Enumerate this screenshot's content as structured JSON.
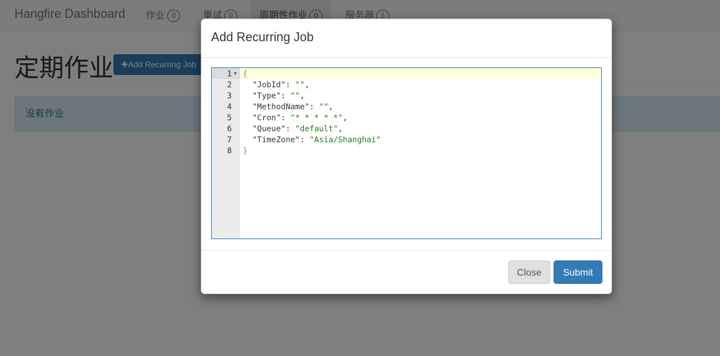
{
  "navbar": {
    "brand": "Hangfire Dashboard",
    "items": [
      {
        "label": "作业",
        "count": "0"
      },
      {
        "label": "重试",
        "count": "0"
      },
      {
        "label": "周期性作业",
        "count": "0"
      },
      {
        "label": "服务器",
        "count": "1"
      }
    ]
  },
  "page": {
    "title": "定期作业",
    "add_button": "Add Recurring Job",
    "empty_message": "没有作业"
  },
  "modal": {
    "title": "Add Recurring Job",
    "editor": {
      "line_numbers": [
        "1",
        "2",
        "3",
        "4",
        "5",
        "6",
        "7",
        "8"
      ],
      "lines": [
        {
          "open": "{"
        },
        {
          "key": "\"JobId\"",
          "value": "\"\"",
          "trail": ","
        },
        {
          "key": "\"Type\"",
          "value": "\"\"",
          "trail": ","
        },
        {
          "key": "\"MethodName\"",
          "value": "\"\"",
          "trail": ","
        },
        {
          "key": "\"Cron\"",
          "value": "\"* * * * *\"",
          "trail": ","
        },
        {
          "key": "\"Queue\"",
          "value": "\"default\"",
          "trail": ","
        },
        {
          "key": "\"TimeZone\"",
          "value": "\"Asia/Shanghai\"",
          "trail": ""
        },
        {
          "close": "}"
        }
      ]
    },
    "close_button": "Close",
    "submit_button": "Submit"
  },
  "colors": {
    "primary": "#337ab7",
    "string": "#1a7f1a",
    "alert_bg": "#d9edf7"
  }
}
